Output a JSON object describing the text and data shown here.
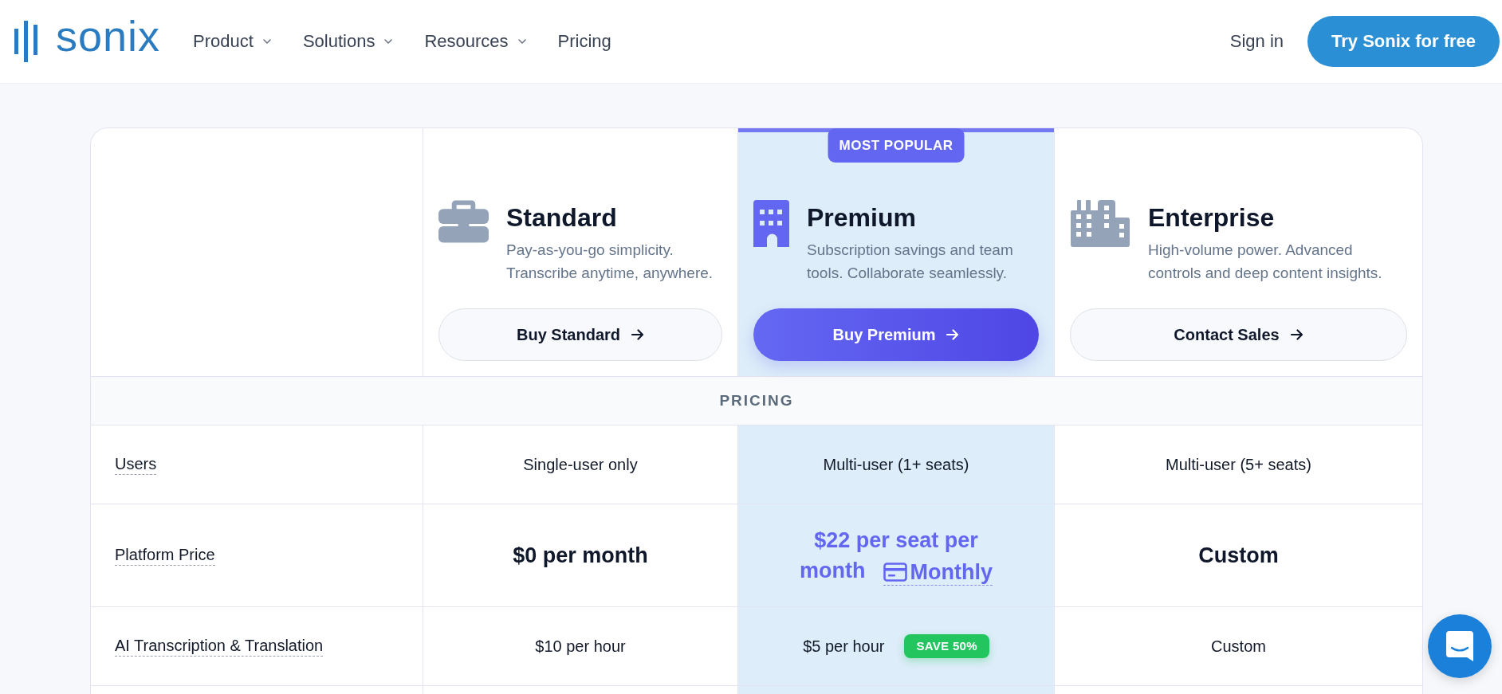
{
  "header": {
    "logo": "sonix",
    "nav": [
      {
        "label": "Product",
        "dropdown": true
      },
      {
        "label": "Solutions",
        "dropdown": true
      },
      {
        "label": "Resources",
        "dropdown": true
      },
      {
        "label": "Pricing",
        "dropdown": false
      }
    ],
    "sign_in": "Sign in",
    "cta": "Try Sonix for free"
  },
  "plans": [
    {
      "name": "Standard",
      "description": "Pay-as-you-go simplicity. Transcribe anytime, anywhere.",
      "button": "Buy Standard",
      "featured": false
    },
    {
      "name": "Premium",
      "description": "Subscription savings and team tools. Collaborate seamlessly.",
      "button": "Buy Premium",
      "featured": true,
      "badge": "MOST POPULAR"
    },
    {
      "name": "Enterprise",
      "description": "High-volume power. Advanced controls and deep content insights.",
      "button": "Contact Sales",
      "featured": false
    }
  ],
  "comparison": {
    "section": "PRICING",
    "rows": [
      {
        "label": "Users",
        "cells": [
          {
            "kind": "plain",
            "text": "Single-user only"
          },
          {
            "kind": "plain",
            "text": "Multi-user (1+ seats)"
          },
          {
            "kind": "plain",
            "text": "Multi-user (5+ seats)"
          }
        ]
      },
      {
        "label": "Platform Price",
        "cells": [
          {
            "kind": "price",
            "text": "$0 per month"
          },
          {
            "kind": "price",
            "text": "$22 per seat per month",
            "link": "Monthly"
          },
          {
            "kind": "price",
            "text": "Custom"
          }
        ]
      },
      {
        "label": "AI Transcription & Translation",
        "cells": [
          {
            "kind": "plain",
            "text": "$10 per hour"
          },
          {
            "kind": "plain",
            "text": "$5 per hour",
            "badge": "SAVE 50%"
          },
          {
            "kind": "plain",
            "text": "Custom"
          }
        ]
      }
    ]
  }
}
